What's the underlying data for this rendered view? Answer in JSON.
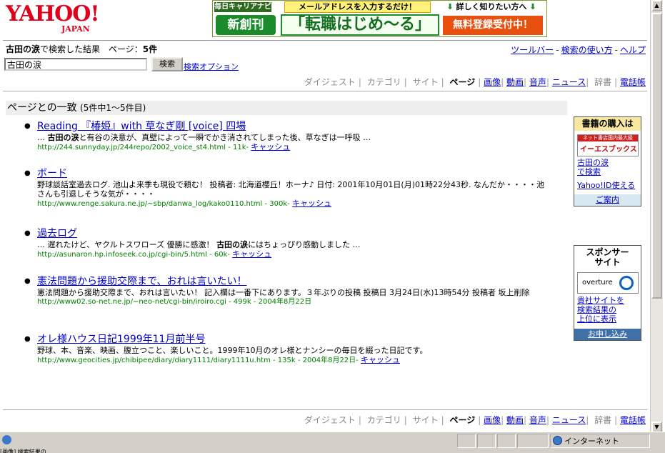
{
  "header": {
    "logo_main": "YAHOO!",
    "logo_sub": "JAPAN",
    "banner": {
      "brand": "毎日キャリアナビ",
      "email_prompt": "メールアドレスを入力するだけ！",
      "more": "詳しく知りたい方へ",
      "new": "新創刊",
      "catch": "「転職はじめ～る」",
      "register": "無料登録受付中！"
    }
  },
  "summary": {
    "query": "古田の涙",
    "suffix": "で検索した結果　ページ：",
    "count": "5件"
  },
  "toplinks": [
    "ツールバー",
    "検索の使い方",
    "ヘルプ"
  ],
  "search": {
    "value": "古田の涙",
    "button": "検索",
    "options": "検索オプション"
  },
  "tabs": [
    {
      "label": "ダイジェスト",
      "state": "disabled"
    },
    {
      "label": "カテゴリ",
      "state": "disabled"
    },
    {
      "label": "サイト",
      "state": "disabled"
    },
    {
      "label": "ページ",
      "state": "current"
    },
    {
      "label": "画像",
      "state": "link"
    },
    {
      "label": "動画",
      "state": "link"
    },
    {
      "label": "音声",
      "state": "link"
    },
    {
      "label": "ニュース",
      "state": "link"
    },
    {
      "label": "辞書",
      "state": "disabled"
    },
    {
      "label": "電話帳",
      "state": "link"
    }
  ],
  "section": {
    "title": "ページとの一致",
    "range": "(5件中1～5件目)"
  },
  "results": [
    {
      "title": "Reading 『椿姫』with 草なぎ剛 [voice] 四場",
      "snippet_pre": "… ",
      "snippet_bold": "古田の涙",
      "snippet_post": "と有谷の決意が、真壁によって一瞬でかき消されてしまった後、草なぎは一呼吸 …",
      "url": "http://244.sunnyday.jp/244repo/2002_voice_st4.html - 11k- ",
      "cache": "キャッシュ"
    },
    {
      "title": "ボード",
      "snippet_pre": "野球談話室過去ログ. 池山よ来季も現役で頼む！ 投稿者: 北海道櫻丘！ホーナ♪ 日付: 2001年10月01日(月)01時22分43秒. なんだか・・・・池さんも引退しそうな気が・・・・",
      "snippet_bold": "",
      "snippet_post": "",
      "url": "http://www.renge.sakura.ne.jp/~sbp/danwa_log/kako0110.html - 300k- ",
      "cache": "キャッシュ"
    },
    {
      "title": "過去ログ",
      "snippet_pre": "… 遅れたけど、ヤクルトスワローズ 優勝に感激！ ",
      "snippet_bold": "古田の涙",
      "snippet_post": "にはちょっぴり感動しました …",
      "url": "http://asunaron.hp.infoseek.co.jp/cgi-bin/5.html - 60k- ",
      "cache": "キャッシュ"
    },
    {
      "title": "憲法問題から援助交際まで、おれは言いたい！",
      "snippet_pre": "憲法問題から援助交際まで、おれは言いたい！ 記入欄は一番下にあります。３年ぶりの投稿 投稿日 3月24日(水)13時54分 投稿者 坂上削除",
      "snippet_bold": "",
      "snippet_post": "",
      "url": "http://www02.so-net.ne.jp/~neo-net/cgi-bin/iroiro.cgi - 499k - 2004年8月22日",
      "cache": ""
    },
    {
      "title": "オレ様ハウス日記1999年11月前半号",
      "snippet_pre": "野球、本、音楽、映画、腹立つこと、楽しいこと。1999年10月のオレ様とナンシーの毎日を綴った日記です。",
      "snippet_bold": "",
      "snippet_post": "",
      "url": "http://www.geocities.jp/chibipee/diary/diary1111/diary1111u.htm - 135k - 2004年8月22日- ",
      "cache": "キャッシュ"
    }
  ],
  "side_books": {
    "header": "書籍の購入は",
    "logo_top": "ネット書店国内最大級",
    "logo_main": "イーエスブックス",
    "link": "古田の涙\nで検索",
    "link2": "Yahoo!ID使える",
    "foot": "ご案内"
  },
  "side_sponsor": {
    "header": "スポンサー\nサイト",
    "logo": "overture",
    "link": "貴社サイトを\n検索結果の\n上位に表示",
    "foot": "お申し込み"
  },
  "statusbar": {
    "zone": "インターネット",
    "task": "[画像] 検索結果の…"
  }
}
